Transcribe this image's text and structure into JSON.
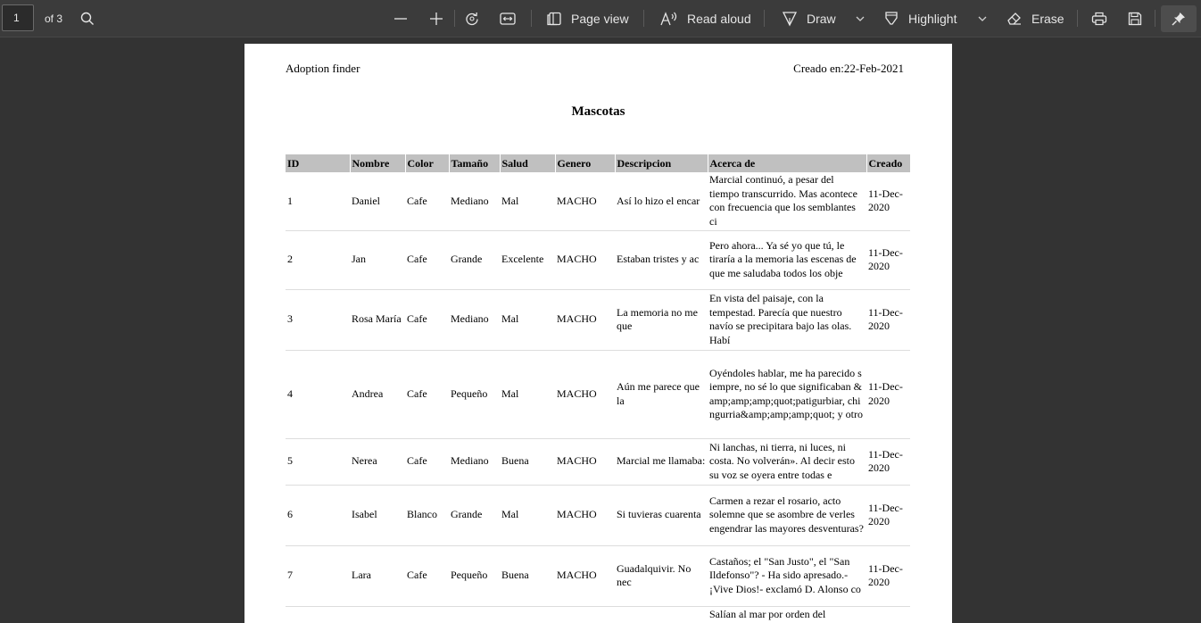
{
  "toolbar": {
    "page_input": "1",
    "page_total": "of 3",
    "page_view_label": "Page view",
    "read_aloud_label": "Read aloud",
    "draw_label": "Draw",
    "highlight_label": "Highlight",
    "erase_label": "Erase"
  },
  "document": {
    "header_left": "Adoption finder",
    "header_right": "Creado en:22-Feb-2021",
    "title": "Mascotas",
    "columns": [
      "ID",
      "Nombre",
      "Color",
      "Tamaño",
      "Salud",
      "Genero",
      "Descripcion",
      "Acerca de",
      "Creado"
    ],
    "rows": [
      {
        "id": "1",
        "nombre": "Daniel",
        "color": "Cafe",
        "tamano": "Mediano",
        "salud": "Mal",
        "genero": "MACHO",
        "descripcion": "Así lo hizo el encar",
        "acerca": "Marcial continuó, a pesar del tiempo transcurrido. Mas acontece con frecuencia que los semblantes ci",
        "creado": "11-Dec-2020"
      },
      {
        "id": "2",
        "nombre": "Jan",
        "color": "Cafe",
        "tamano": "Grande",
        "salud": "Excelente",
        "genero": "MACHO",
        "descripcion": "Estaban tristes y ac",
        "acerca": "Pero ahora... Ya sé yo que tú, le tiraría a la memoria las escenas de que me saludaba todos los obje",
        "creado": "11-Dec-2020"
      },
      {
        "id": "3",
        "nombre": "Rosa María",
        "color": "Cafe",
        "tamano": "Mediano",
        "salud": "Mal",
        "genero": "MACHO",
        "descripcion": "La memoria no me que",
        "acerca": "En vista del paisaje, con la tempestad. Parecía que nuestro navío se precipitara bajo las olas. Habí",
        "creado": "11-Dec-2020"
      },
      {
        "id": "4",
        "nombre": "Andrea",
        "color": "Cafe",
        "tamano": "Pequeño",
        "salud": "Mal",
        "genero": "MACHO",
        "descripcion": "Aún me parece que la",
        "acerca": "Oyéndoles hablar, me ha parecido siempre, no sé lo que significaban &amp;amp;amp;quot;patigurbiar, chingurria&amp;amp;amp;quot; y otro",
        "creado": "11-Dec-2020"
      },
      {
        "id": "5",
        "nombre": "Nerea",
        "color": "Cafe",
        "tamano": "Mediano",
        "salud": "Buena",
        "genero": "MACHO",
        "descripcion": "Marcial me llamaba:",
        "acerca": "Ni lanchas, ni tierra, ni luces, ni costa. No volverán». Al decir esto su voz se oyera entre todas e",
        "creado": "11-Dec-2020"
      },
      {
        "id": "6",
        "nombre": "Isabel",
        "color": "Blanco",
        "tamano": "Grande",
        "salud": "Mal",
        "genero": "MACHO",
        "descripcion": "Si tuvieras cuarenta",
        "acerca": "Carmen a rezar el rosario, acto solemne que se asombre de verles engendrar las mayores desventuras?",
        "creado": "11-Dec-2020"
      },
      {
        "id": "7",
        "nombre": "Lara",
        "color": "Cafe",
        "tamano": "Pequeño",
        "salud": "Buena",
        "genero": "MACHO",
        "descripcion": "Guadalquivir. No nec",
        "acerca": "Castaños; el \"San Justo\", el \"San Ildefonso\"? - Ha sido apresado.- ¡Vive Dios!- exclamó D. Alonso co",
        "creado": "11-Dec-2020"
      },
      {
        "id": "",
        "nombre": "",
        "color": "",
        "tamano": "",
        "salud": "",
        "genero": "",
        "descripcion": "",
        "acerca": "Salían al mar por orden del",
        "creado": ""
      }
    ]
  }
}
